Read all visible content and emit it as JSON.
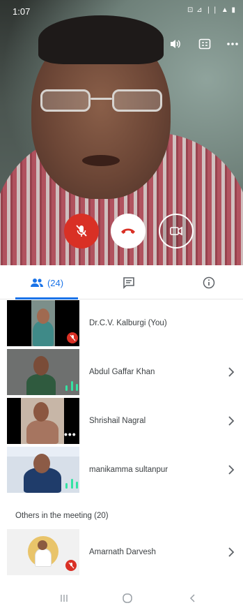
{
  "status_bar": {
    "time": "1:07",
    "system_icons_text": "⊡ ⊿ ❘❘ ▲ ▮"
  },
  "video": {
    "speaker": "Dr.C.V. Kalburgi"
  },
  "top_controls": {
    "icons": [
      "speaker-icon",
      "captions-icon",
      "more-vert-icon"
    ]
  },
  "call_controls": {
    "mic_icon": "mic-off-icon",
    "end_icon": "call-end-icon",
    "camera_icon": "camera-switch-icon"
  },
  "tabs": {
    "people_count": "(24)",
    "people_icon": "people-icon",
    "chat_icon": "chat-icon",
    "info_icon": "info-icon"
  },
  "participants": [
    {
      "name": "Dr.C.V. Kalburgi (You)",
      "status": "muted"
    },
    {
      "name": "Abdul Gaffar Khan",
      "status": "speaking"
    },
    {
      "name": "Shrishail Nagral",
      "status": "more"
    },
    {
      "name": "manikamma sultanpur",
      "status": "speaking"
    }
  ],
  "others_section": {
    "title": "Others in the meeting (20)"
  },
  "others": [
    {
      "name": "Amarnath Darvesh",
      "status": "muted"
    }
  ],
  "colors": {
    "accent": "#1a73e8",
    "danger": "#d93025",
    "audio": "#34e3a3"
  }
}
